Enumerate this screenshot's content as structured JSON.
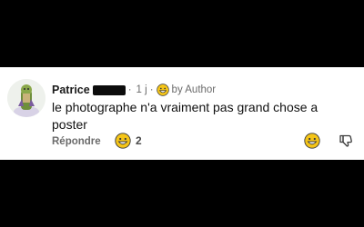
{
  "comment": {
    "author": "Patrice",
    "time": "1 j",
    "separator": "·",
    "badge_label": "by Author",
    "text": "le photographe n'a vraiment pas grand chose a poster",
    "reply_label": "Répondre",
    "reaction_count": "2"
  },
  "icons": {
    "avatar": "avatar-illustration",
    "badge": "author-emoji-icon",
    "reaction": "grin-emoji-icon",
    "add_reaction": "grin-emoji-icon",
    "dislike": "thumbs-down-icon"
  },
  "colors": {
    "background": "#000000",
    "card": "#ffffff",
    "text": "#111111",
    "muted": "#6b6b6b",
    "emoji": "#f5c518"
  }
}
